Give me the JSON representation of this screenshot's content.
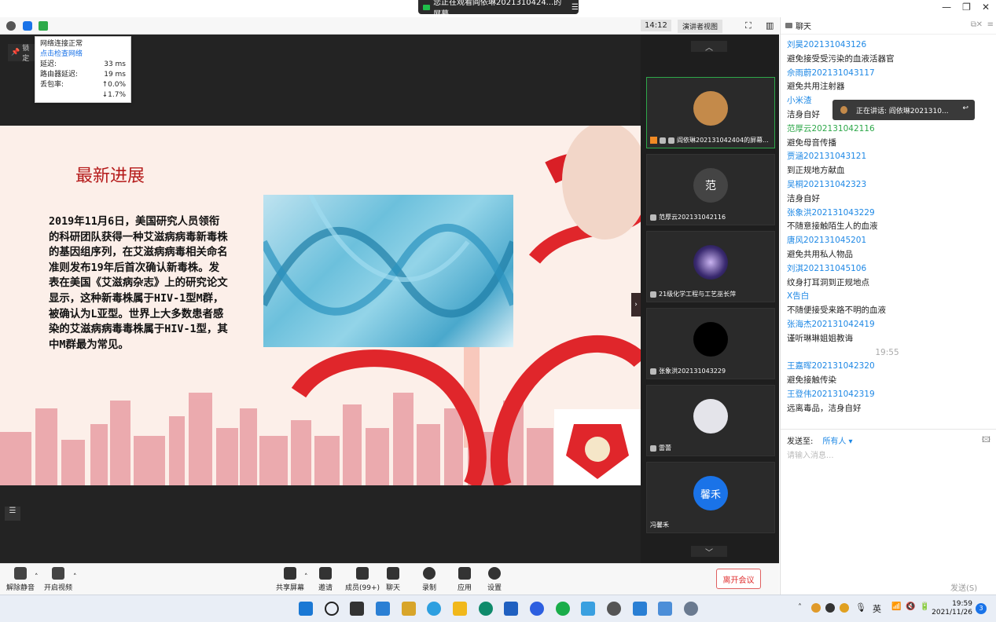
{
  "banner": {
    "text": "您正在观看阎依琳2021310424...的屏幕"
  },
  "top_toolbar": {
    "time": "14:12",
    "view_mode": "演讲者视图"
  },
  "network": {
    "title": "网络连接正常",
    "check_link": "点击检查网络",
    "rows": [
      {
        "label": "延迟:",
        "value": "33 ms"
      },
      {
        "label": "路由器延迟:",
        "value": "19 ms"
      },
      {
        "label": "丢包率:",
        "value": "↑0.0%"
      },
      {
        "label": "",
        "value": "↓1.7%"
      }
    ],
    "lock_label": "锁定"
  },
  "slide": {
    "title": "最新进展",
    "body": "2019年11月6日，美国研究人员领衔的科研团队获得一种艾滋病病毒新毒株的基因组序列，在艾滋病病毒相关命名准则发布19年后首次确认新毒株。发表在美国《艾滋病杂志》上的研究论文显示，这种新毒株属于HIV-1型M群，被确认为L亚型。世界上大多数患者感染的艾滋病病毒毒株属于HIV-1型，其中M群最为常见。"
  },
  "participants": [
    {
      "name": "阎依琳2021310424​04的屏幕...",
      "avatar_color": "#c48a4a"
    },
    {
      "name": "范厚云202131042116",
      "avatar_text": "范",
      "avatar_color": "#444444"
    },
    {
      "name": "21级化学工程与工艺巫长萍",
      "avatar_color": "#5b3f8a"
    },
    {
      "name": "张象洪202131043229",
      "avatar_color": "#000000"
    },
    {
      "name": "雷蕾",
      "avatar_color": "#d8d8e0"
    },
    {
      "name": "冯馨禾",
      "avatar_text": "馨禾",
      "avatar_color": "#1a73e8"
    }
  ],
  "bottom_bar": {
    "unmute": "解除静音",
    "start_video": "开启视频",
    "share": "共享屏幕",
    "invite": "邀请",
    "members": "成员(99+)",
    "chat": "聊天",
    "record": "录制",
    "apps": "应用",
    "settings": "设置",
    "leave": "离开会议"
  },
  "chat": {
    "title": "聊天",
    "speaking": "正在讲话: 阎依琳2021310...",
    "messages": [
      {
        "name": "刘昊202131043126",
        "msg": "避免接受受污染的血液活器官"
      },
      {
        "name": "佘雨蔚202131043117",
        "msg": "避免共用注射器"
      },
      {
        "name": "小米渣",
        "msg": "洁身自好"
      },
      {
        "name": "范厚云202131042116",
        "msg": "避免母音传播"
      },
      {
        "name": "贾涵202131043121",
        "msg": "到正规地方献血"
      },
      {
        "name": "吴桐202131042323",
        "msg": "洁身自好"
      },
      {
        "name": "张象洪202131043229",
        "msg": "不随意接触陌生人的血液"
      },
      {
        "name": "唐风202131045201",
        "msg": "避免共用私人物品"
      },
      {
        "name": "刘淇202131045106",
        "msg": "纹身打耳洞到正规地点"
      },
      {
        "name": "X告白",
        "msg": "不随便接受来路不明的血液"
      },
      {
        "name": "张海杰202131042419",
        "msg": "谨听琳琳姐姐教诲"
      }
    ],
    "time_divider": "19:55",
    "messages2": [
      {
        "name": "王嘉晖202131042320",
        "msg": "避免接触传染"
      },
      {
        "name": "王登伟202131042319",
        "msg": "远离毒品，洁身自好"
      }
    ],
    "send_to_label": "发送至:",
    "send_to_value": "所有人 ▾",
    "input_placeholder": "请输入消息...",
    "send_button": "发送(S)"
  },
  "taskbar": {
    "ime": "英",
    "time": "19:59",
    "date": "2021/11/26",
    "badge": "3"
  }
}
